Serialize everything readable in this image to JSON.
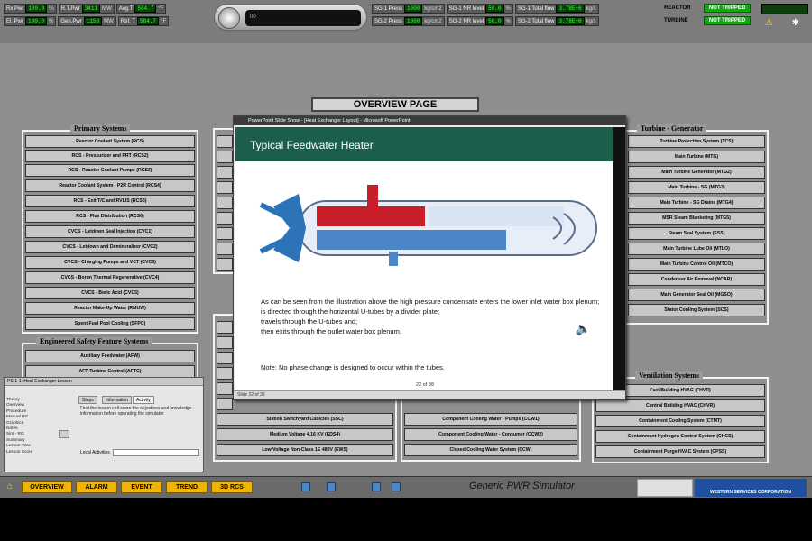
{
  "status_rows": {
    "row1": [
      {
        "label": "Rx Pwr",
        "value": "100.0",
        "unit": "%"
      },
      {
        "label": "R.T.Pwr",
        "value": "3411",
        "unit": "MW"
      },
      {
        "label": "Avg.T",
        "value": "584.7",
        "unit": "°F"
      },
      {
        "label": "SG-1 Press",
        "value": "1000",
        "unit": "kg/cm2"
      },
      {
        "label": "SG-1 NR level",
        "value": "50.0",
        "unit": "%"
      },
      {
        "label": "SG-1 Total flow",
        "value": "3.78E+6",
        "unit": "kg/s"
      }
    ],
    "row2": [
      {
        "label": "El. Pwr",
        "value": "100.0",
        "unit": "%"
      },
      {
        "label": "Gen.Pwr",
        "value": "1150",
        "unit": "MW"
      },
      {
        "label": "Ref. T",
        "value": "584.7",
        "unit": "°F"
      },
      {
        "label": "SG-2 Press",
        "value": "1000",
        "unit": "kg/cm2"
      },
      {
        "label": "SG-2 NR level",
        "value": "50.0",
        "unit": "%"
      },
      {
        "label": "SG-2 Total flow",
        "value": "3.78E+6",
        "unit": "kg/s"
      }
    ]
  },
  "trips": {
    "reactor_label": "REACTOR",
    "reactor_status": "NOT TRIPPED",
    "turbine_label": "TURBINE",
    "turbine_status": "NOT TRIPPED"
  },
  "player_text": "00",
  "overview_title": "OVERVIEW PAGE",
  "primary": {
    "title": "Primary Systems",
    "items": [
      "Reactor Coolant System (RCS)",
      "RCS - Pressurizer and PRT (RCS2)",
      "RCS - Reactor Coolant Pumps (RCS3)",
      "Reactor Coolant System - P2R Control (RCS4)",
      "RCS - Exit T/C and RVLIS (RCS5)",
      "RCS - Flux Distribution (RCS6)",
      "CVCS - Letdown Seal Injection (CVC1)",
      "CVCS - Letdown and Demineralizer (CVC2)",
      "CVCS - Charging Pumps and VCT (CVC3)",
      "CVCS - Boron Thermal Regenerative (CVC4)",
      "CVCS - Boric Acid (CVC5)",
      "Reactor Make-Up Water (RMUW)",
      "Spent Fuel Pool Cooling (SFPC)"
    ]
  },
  "esf": {
    "title": "Engineered Safety Feature Systems",
    "items": [
      "Auxiliary Feedwater (AFW)",
      "AFP Turbine Control (AFTC)"
    ]
  },
  "turbine": {
    "title": "Turbine - Generator",
    "items": [
      "Turbine Protection System (TCS)",
      "Main Turbine (MTG)",
      "Main Turbine Generator (MTG2)",
      "Main Turbine - SG (MTG3)",
      "Main Turbine - SG Drains (MTG4)",
      "MSR Steam Blanketing (MTG5)",
      "Steam Seal System (SSS)",
      "Main Turbine Lube Oil (MTLO)",
      "Main Turbine Control Oil (MTCO)",
      "Condenser Air Removal (NCAR)",
      "Main Generator Seal Oil (MGSO)",
      "Stator Cooling System (SCS)"
    ]
  },
  "ventilation": {
    "title": "Ventilation Systems",
    "items": [
      "Fuel Building HVAC (FHVR)",
      "Control Building HVAC (CHVR)",
      "Containment Cooling System (CTMT)",
      "Containment Hydrogen Control System (CHCS)",
      "Containment Purge HVAC System (CPSS)"
    ]
  },
  "electrical": {
    "items": [
      "Station Switchyard Cubicles (SSC)",
      "Medium Voltage 4.16 KV (EDS4)",
      "Low Voltage Non-Class 1E 480V (EWS)"
    ]
  },
  "cooling": {
    "items": [
      "Component Cooling Water - Pumps (CCW1)",
      "Component Cooling Water - Consumer (CCW2)",
      "Closed Cooling Water System (CCW)"
    ]
  },
  "popup": {
    "titlebar": "PowerPoint Slide Show - [Heat Exchanger Layout] - Microsoft PowerPoint",
    "slide_title": "Typical Feedwater Heater",
    "paragraphs": [
      "As can be seen from the illustration above the high pressure condensate enters the lower inlet water box plenum;",
      "is directed through the horizontal U-tubes by a divider plate;",
      "travels through the U-tubes and;",
      "then exits through the outlet water box plenum."
    ],
    "note": "Note: No phase change is designed to occur within the tubes.",
    "slide_number": "22 of 38",
    "statusbar": "Slide 22 of 38"
  },
  "tutorial": {
    "title": "PS-1-1: Heat Exchanger Lesson",
    "tabs": [
      "Steps",
      "Information",
      "Activity"
    ],
    "left_lines": [
      "Theory",
      "Overview",
      "Procedure",
      "Manual RG",
      "Graphics",
      "Notes",
      "Sim - RG",
      "Summary",
      "Lesson Time",
      "Lesson Score"
    ],
    "text": "Find the lesson cell score the objectives and knowledge information before operating the simulator",
    "local_activities": "Local Activities"
  },
  "toolbar": {
    "buttons": [
      "OVERVIEW",
      "ALARM",
      "EVENT",
      "TREND",
      "3D RCS"
    ],
    "simulator_title": "Generic PWR Simulator",
    "logo2_text": "WESTERN SERVICES CORPORATION"
  },
  "colors": {
    "background": "#8e8e8e",
    "accent_green": "#15a615",
    "toolbar_button": "#f0b400",
    "slide_header": "#1b5e4b"
  }
}
